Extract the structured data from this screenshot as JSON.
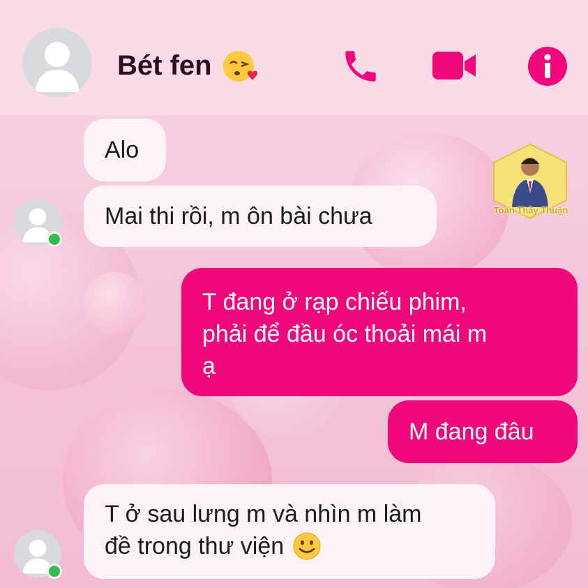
{
  "header": {
    "contact_name": "Bét fen",
    "name_emoji": "kissing-heart-emoji",
    "actions": [
      "phone-icon",
      "video-camera-icon",
      "info-icon"
    ]
  },
  "watermark": {
    "name": "Toán Thầy Thuận"
  },
  "messages": [
    {
      "side": "incoming",
      "text": "Alo"
    },
    {
      "side": "incoming",
      "text": "Mai thi rồi, m ôn bài chưa"
    },
    {
      "side": "outgoing",
      "lines": [
        "T đang ở rạp chiếu phim,",
        "phải để đầu óc thoải mái m",
        "ạ"
      ]
    },
    {
      "side": "outgoing",
      "text": "M đang đâu"
    },
    {
      "side": "incoming",
      "lines": [
        "T ở sau lưng m và nhìn m làm",
        "đề trong thư viện"
      ],
      "emoji": "smile-emoji"
    }
  ],
  "colors": {
    "accent": "#f0077b",
    "incoming_bubble": "#fdf3f6",
    "header_bg": "#fbdbe8",
    "online": "#2fbf4a"
  }
}
